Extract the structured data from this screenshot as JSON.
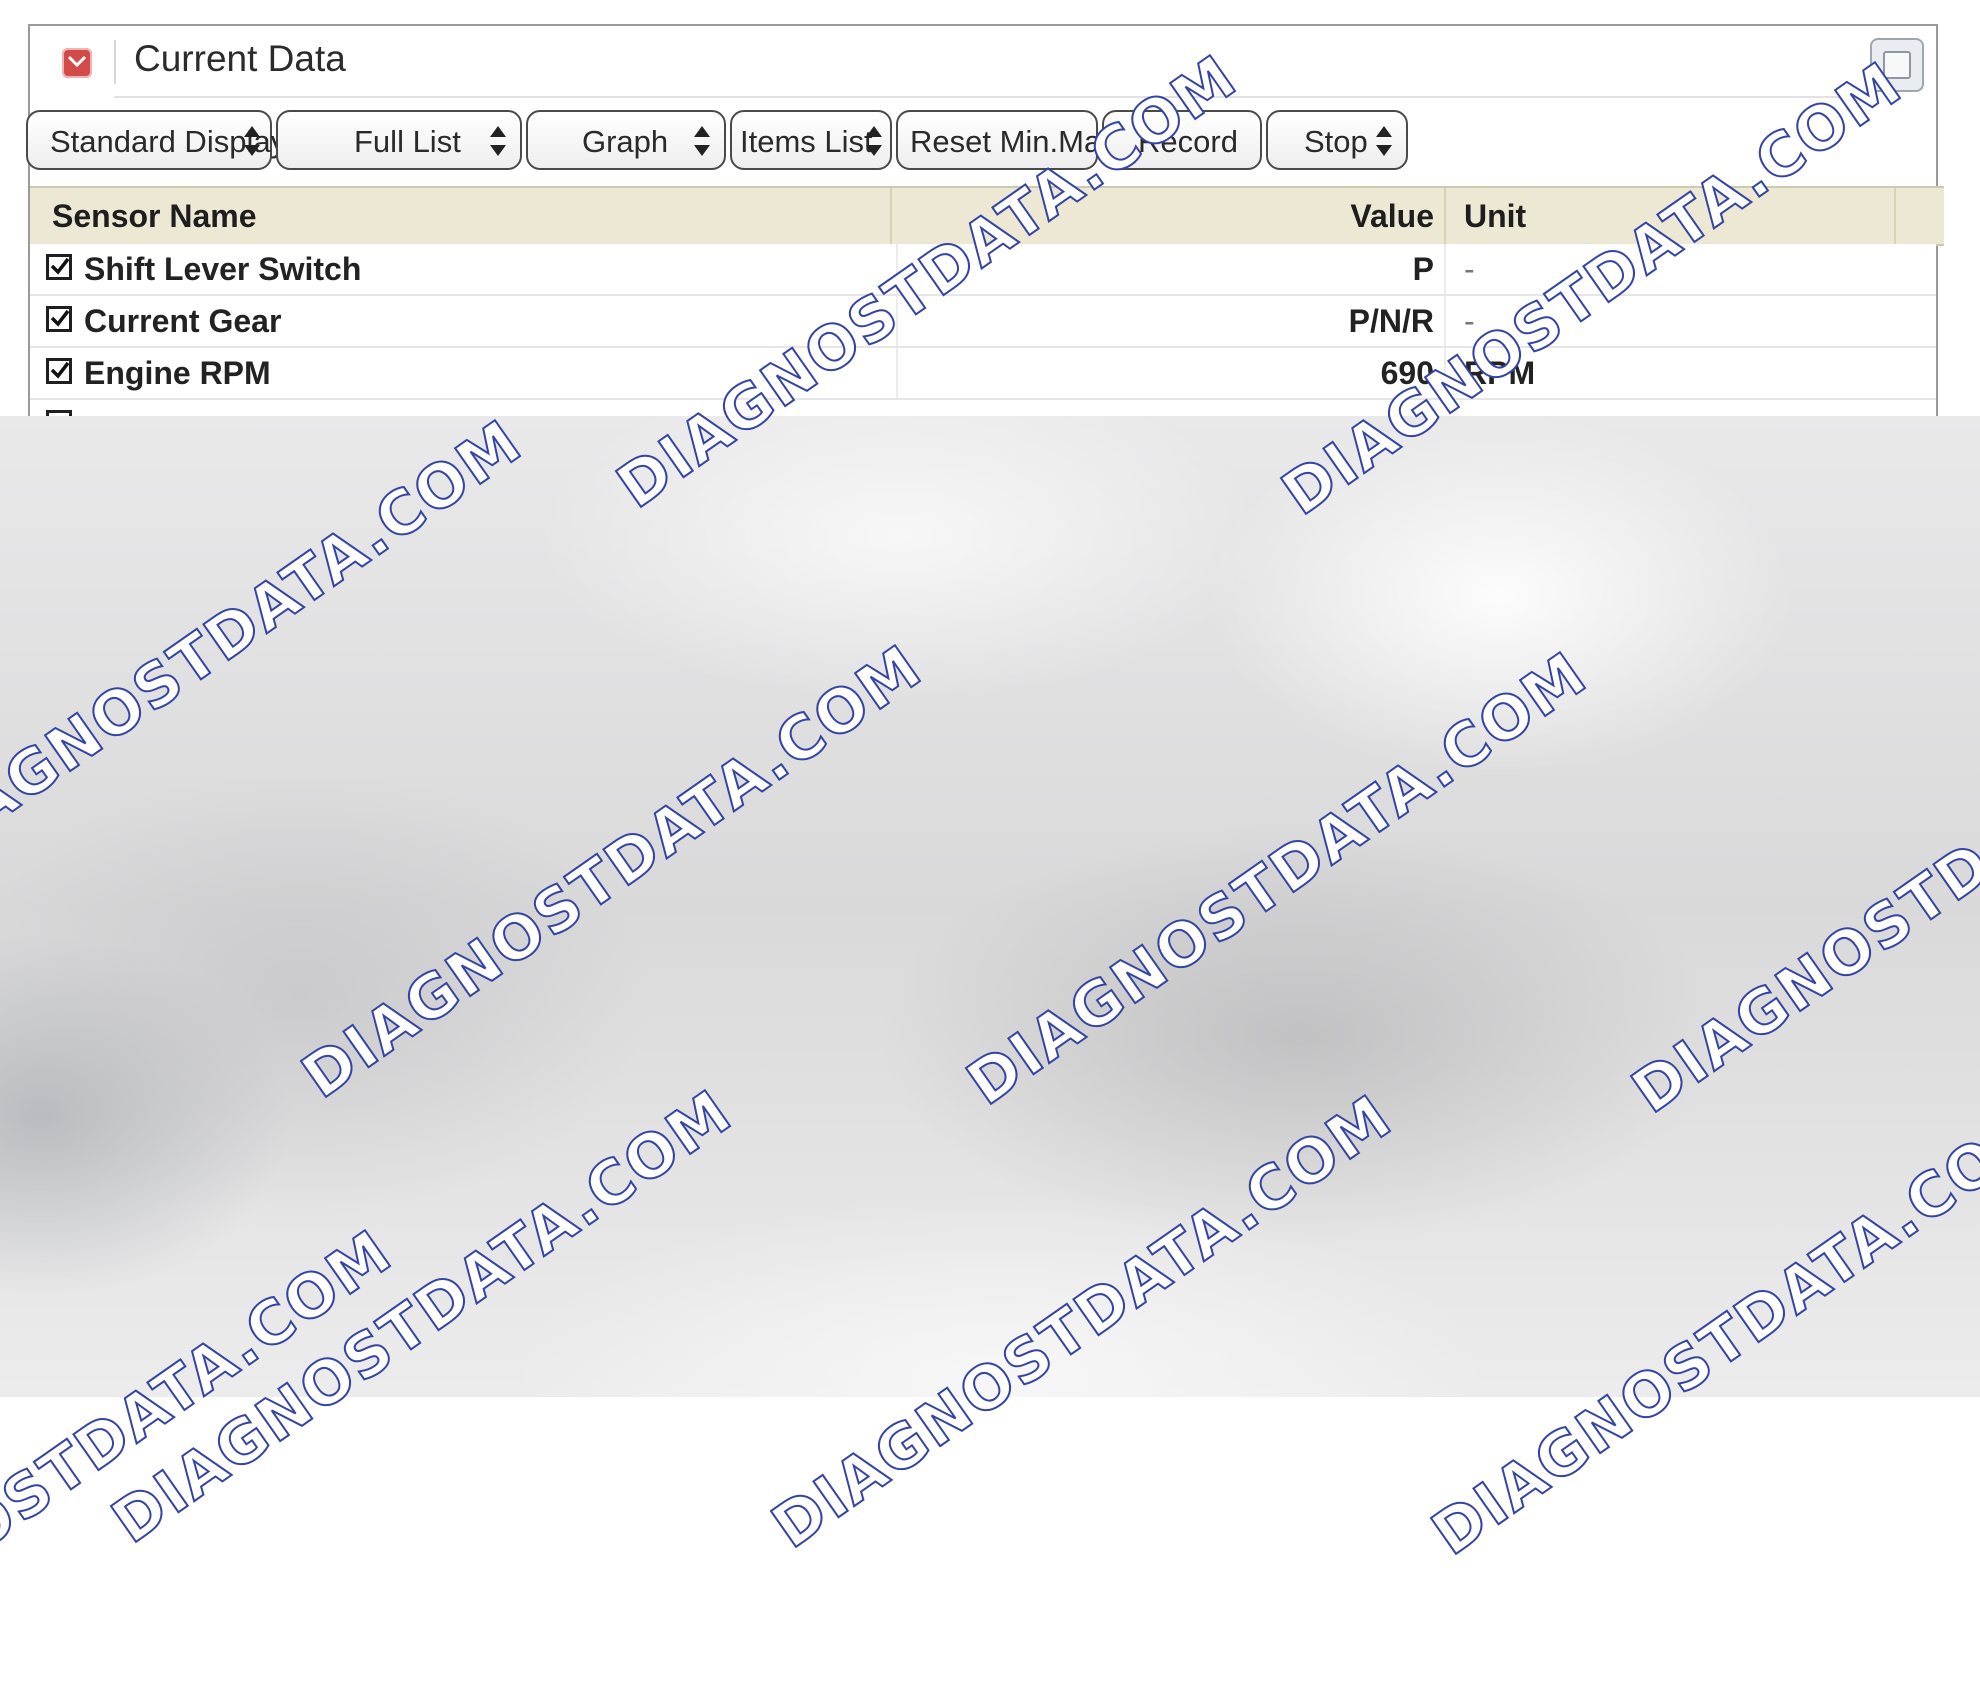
{
  "window": {
    "title": "Current Data"
  },
  "toolbar": {
    "standard_display": "Standard Display",
    "full_list": "Full List",
    "graph": "Graph",
    "items_list": "Items List",
    "reset_min_max": "Reset Min.Max.",
    "record": "Record",
    "stop": "Stop"
  },
  "table": {
    "headers": {
      "sensor_name": "Sensor Name",
      "value": "Value",
      "unit": "Unit"
    },
    "rows": [
      {
        "name": "Shift Lever Switch",
        "value": "P",
        "unit": "-",
        "checked": true
      },
      {
        "name": "Current Gear",
        "value": "P/N/R",
        "unit": "-",
        "checked": true
      },
      {
        "name": "Engine RPM",
        "value": "690",
        "unit": "RPM",
        "checked": true
      }
    ]
  },
  "watermark": {
    "text": "DIAGNOSTDATA.COM",
    "color": "#3444a4"
  },
  "colors": {
    "header_bg": "#ece8d4",
    "app_icon": "#d24a4a"
  }
}
